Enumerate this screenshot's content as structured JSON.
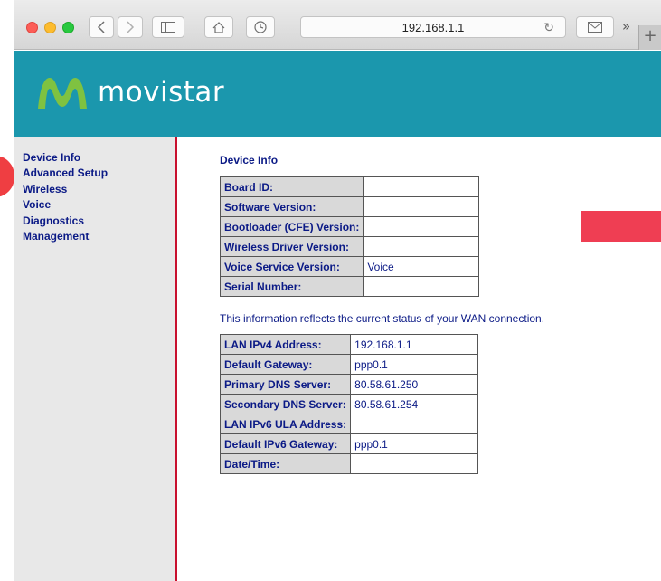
{
  "browser": {
    "address": "192.168.1.1",
    "icons": [
      "back-icon",
      "forward-icon",
      "sidebar-icon",
      "home-icon",
      "history-icon",
      "reload-icon",
      "mail-icon",
      "more-icon",
      "new-tab-icon"
    ],
    "more_label": "»",
    "new_tab_label": "+"
  },
  "banner": {
    "brand": "movistar",
    "bg_color": "#1b97ad"
  },
  "sidebar": {
    "items": [
      {
        "label": "Device Info"
      },
      {
        "label": "Advanced Setup"
      },
      {
        "label": "Wireless"
      },
      {
        "label": "Voice"
      },
      {
        "label": "Diagnostics"
      },
      {
        "label": "Management"
      }
    ]
  },
  "main": {
    "title": "Device Info",
    "device_table": [
      {
        "label": "Board ID:",
        "value": ""
      },
      {
        "label": "Software Version:",
        "value": ""
      },
      {
        "label": "Bootloader (CFE) Version:",
        "value": ""
      },
      {
        "label": "Wireless Driver Version:",
        "value": ""
      },
      {
        "label": "Voice Service Version:",
        "value": "Voice"
      },
      {
        "label": "Serial Number:",
        "value": ""
      }
    ],
    "note": "This information reflects the current status of your WAN connection.",
    "wan_table": [
      {
        "label": "LAN IPv4 Address:",
        "value": "192.168.1.1"
      },
      {
        "label": "Default Gateway:",
        "value": "ppp0.1"
      },
      {
        "label": "Primary DNS Server:",
        "value": "80.58.61.250"
      },
      {
        "label": "Secondary DNS Server:",
        "value": "80.58.61.254"
      },
      {
        "label": "LAN IPv6 ULA Address:",
        "value": ""
      },
      {
        "label": "Default IPv6 Gateway:",
        "value": "ppp0.1"
      },
      {
        "label": "Date/Time:",
        "value": ""
      }
    ]
  },
  "colors": {
    "link": "#0b1a86",
    "accent_red": "#ef3e53",
    "sidebar_border": "#c8102e"
  }
}
